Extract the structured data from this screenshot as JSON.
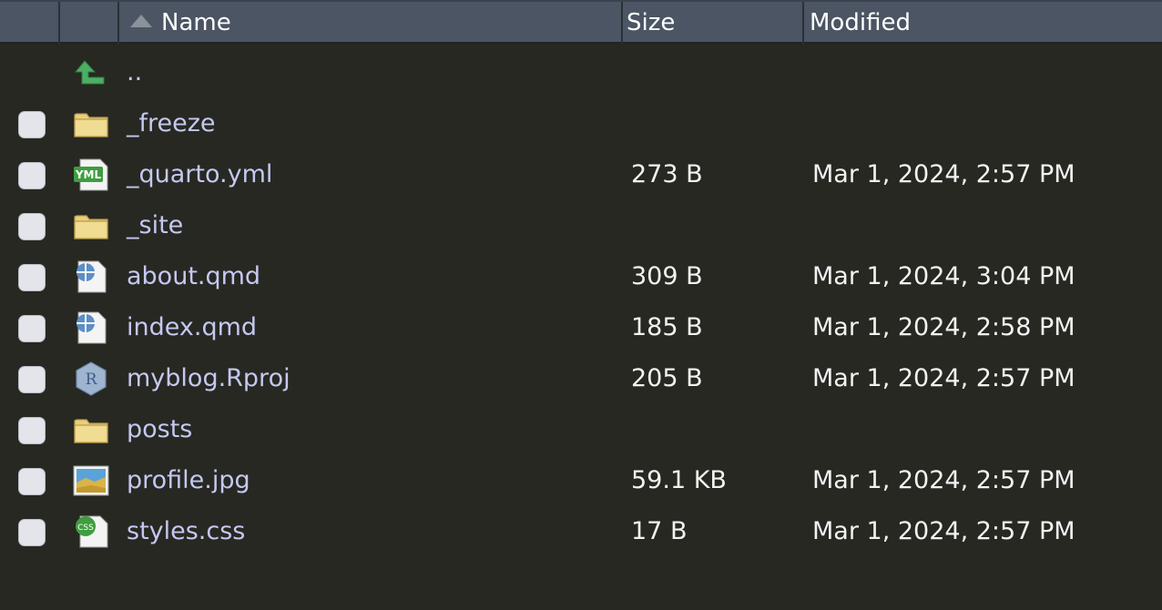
{
  "header": {
    "name_label": "Name",
    "size_label": "Size",
    "modified_label": "Modified",
    "sort_icon": "sort-ascending-icon"
  },
  "files": [
    {
      "name": "..",
      "icon": "parent-directory-icon",
      "checkbox": false,
      "size": "",
      "modified": ""
    },
    {
      "name": "_freeze",
      "icon": "folder-icon",
      "checkbox": true,
      "size": "",
      "modified": ""
    },
    {
      "name": "_quarto.yml",
      "icon": "yml-file-icon",
      "icon_text": "YML",
      "checkbox": true,
      "size": "273 B",
      "modified": "Mar 1, 2024, 2:57 PM"
    },
    {
      "name": "_site",
      "icon": "folder-icon",
      "checkbox": true,
      "size": "",
      "modified": ""
    },
    {
      "name": "about.qmd",
      "icon": "quarto-file-icon",
      "checkbox": true,
      "size": "309 B",
      "modified": "Mar 1, 2024, 3:04 PM"
    },
    {
      "name": "index.qmd",
      "icon": "quarto-file-icon",
      "checkbox": true,
      "size": "185 B",
      "modified": "Mar 1, 2024, 2:58 PM"
    },
    {
      "name": "myblog.Rproj",
      "icon": "rproject-file-icon",
      "icon_text": "R",
      "checkbox": true,
      "size": "205 B",
      "modified": "Mar 1, 2024, 2:57 PM"
    },
    {
      "name": "posts",
      "icon": "folder-icon",
      "checkbox": true,
      "size": "",
      "modified": ""
    },
    {
      "name": "profile.jpg",
      "icon": "image-file-icon",
      "checkbox": true,
      "size": "59.1 KB",
      "modified": "Mar 1, 2024, 2:57 PM"
    },
    {
      "name": "styles.css",
      "icon": "css-file-icon",
      "icon_text": "CSS",
      "checkbox": true,
      "size": "17 B",
      "modified": "Mar 1, 2024, 2:57 PM"
    }
  ],
  "colors": {
    "background": "#272822",
    "header_background": "#4b5563",
    "file_name": "#c5c8f0",
    "text": "#f2f2f2",
    "folder": "#e8cf7e",
    "parent_arrow": "#4caf64",
    "yml_badge": "#3f9d3f",
    "quarto_blue": "#5b8fc6",
    "css_badge": "#3f9d3f"
  }
}
